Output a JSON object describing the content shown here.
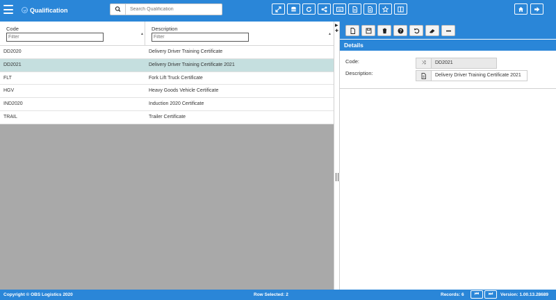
{
  "app": {
    "title": "Qualification",
    "menu_icon": "hamburger-menu-icon",
    "title_icon": "check-circle-icon"
  },
  "search": {
    "placeholder": "Search Qualification",
    "icon": "search-icon"
  },
  "toolbar_icons": [
    "expand-icon",
    "database-icon",
    "refresh-icon",
    "share-icon",
    "keyboard-icon",
    "document-icon",
    "document-alt-icon",
    "star-icon",
    "columns-icon"
  ],
  "toolbar_right_icons": [
    "home-icon",
    "logout-icon"
  ],
  "grid": {
    "columns": [
      {
        "header": "Code",
        "filter_placeholder": "Filter"
      },
      {
        "header": "Description",
        "filter_placeholder": "Filter"
      }
    ],
    "rows": [
      {
        "code": "DD2020",
        "description": "Delivery Driver Training Certificate"
      },
      {
        "code": "DD2021",
        "description": "Delivery Driver Training Certificate 2021"
      },
      {
        "code": "FLT",
        "description": "Fork Lift Truck Certificate"
      },
      {
        "code": "HGV",
        "description": "Heavy Goods Vehicle Certificate"
      },
      {
        "code": "IND2020",
        "description": "Induction 2020 Certificate"
      },
      {
        "code": "TRAIL",
        "description": "Trailer Certificate"
      }
    ],
    "selected_row_index": 1
  },
  "detail_toolbar_icons": [
    "new-document-icon",
    "save-icon",
    "delete-icon",
    "help-icon",
    "undo-icon",
    "eraser-icon",
    "minus-icon"
  ],
  "details": {
    "header": "Details",
    "fields": [
      {
        "label": "Code:",
        "value": "DD2021",
        "icon": "shuffle-icon",
        "readonly": true
      },
      {
        "label": "Description:",
        "value": "Delivery Driver Training Certificate 2021",
        "icon": "document-icon",
        "readonly": false
      }
    ]
  },
  "status": {
    "copyright": "Copyright © OBS Logistics 2020",
    "row_selected": "Row Selected: 2",
    "records": "Records: 6",
    "version": "Version: 1.00.13.28689"
  },
  "colors": {
    "primary": "#2a86d8",
    "selected_row": "#c5dfdf",
    "empty_grid": "#a9a9a9"
  }
}
